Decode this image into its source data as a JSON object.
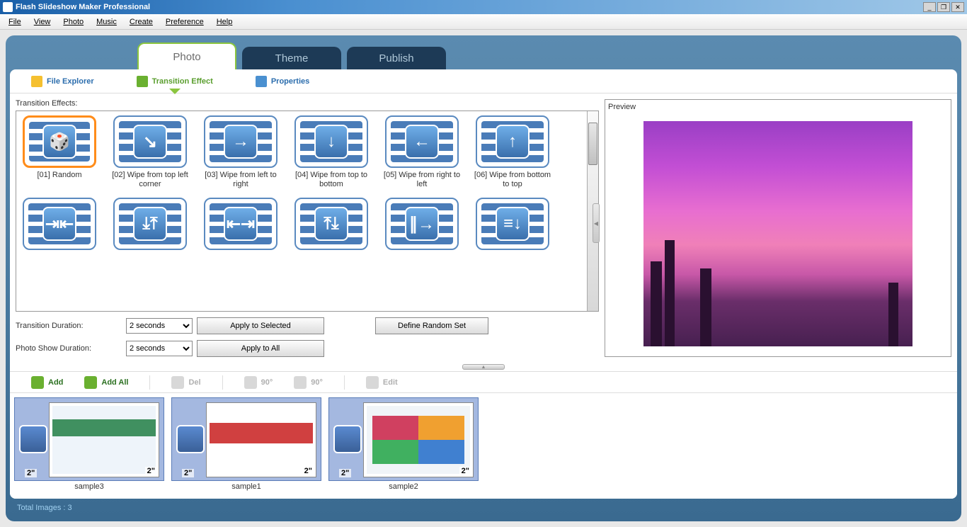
{
  "app": {
    "title": "Flash Slideshow Maker Professional"
  },
  "menu": [
    "File",
    "View",
    "Photo",
    "Music",
    "Create",
    "Preference",
    "Help"
  ],
  "maintabs": {
    "photo": "Photo",
    "theme": "Theme",
    "publish": "Publish"
  },
  "subtabs": {
    "explorer": "File Explorer",
    "transition": "Transition Effect",
    "properties": "Properties"
  },
  "effects": {
    "heading": "Transition Effects:",
    "items": [
      {
        "label": "[01] Random",
        "glyph": "🎲"
      },
      {
        "label": "[02] Wipe from top left corner",
        "glyph": "↘"
      },
      {
        "label": "[03] Wipe from left to right",
        "glyph": "→"
      },
      {
        "label": "[04] Wipe from top to bottom",
        "glyph": "↓"
      },
      {
        "label": "[05] Wipe from right to left",
        "glyph": "←"
      },
      {
        "label": "[06] Wipe from bottom to top",
        "glyph": "↑"
      },
      {
        "label": "",
        "glyph": "⇥⇤"
      },
      {
        "label": "",
        "glyph": "⤓⤒"
      },
      {
        "label": "",
        "glyph": "⇤⇥"
      },
      {
        "label": "",
        "glyph": "⤒⤓"
      },
      {
        "label": "",
        "glyph": "∥→"
      },
      {
        "label": "",
        "glyph": "≡↓"
      }
    ]
  },
  "controls": {
    "trans_dur_label": "Transition Duration:",
    "photo_dur_label": "Photo Show Duration:",
    "trans_dur_value": "2 seconds",
    "photo_dur_value": "2 seconds",
    "apply_selected": "Apply to Selected",
    "apply_all": "Apply to All",
    "define_random": "Define Random Set"
  },
  "preview": {
    "label": "Preview"
  },
  "toolbar2": {
    "add": "Add",
    "addall": "Add All",
    "del": "Del",
    "rotL": "90°",
    "rotR": "90°",
    "edit": "Edit"
  },
  "photos": [
    {
      "name": "sample3",
      "trans_dur": "2\"",
      "show_dur": "2\""
    },
    {
      "name": "sample1",
      "trans_dur": "2\"",
      "show_dur": "2\""
    },
    {
      "name": "sample2",
      "trans_dur": "2\"",
      "show_dur": "2\""
    }
  ],
  "status": "Total Images : 3"
}
